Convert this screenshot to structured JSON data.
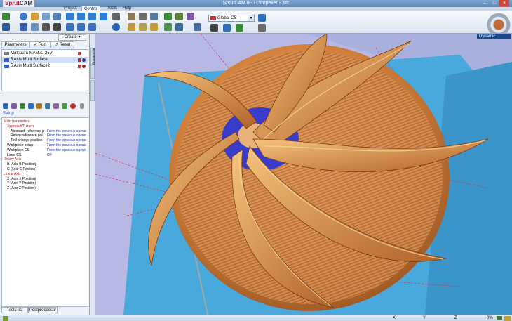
{
  "app": {
    "logo_prefix": "Sprut",
    "logo_suffix": "CAM",
    "window_title": "SprutCAM 8 - D:\\Impeller 3.stc"
  },
  "ribbon": {
    "tabs": [
      "Project",
      "Control",
      "Tools",
      "Help"
    ],
    "active_tab": "Control",
    "coordinate_system": "Global CS"
  },
  "left_panel": {
    "create_label": "Create",
    "buttons": {
      "parameters": "Parameters",
      "run": "Run",
      "reset": "Reset"
    },
    "operations": [
      {
        "label": "Matsuura MAM72 25V",
        "selected": false
      },
      {
        "label": "5 Axis Multi Surface",
        "selected": true
      },
      {
        "label": "5 Axis Multi Surface2",
        "selected": false
      }
    ],
    "setup_label": "Setup",
    "parameters": [
      {
        "key": "Main parameters",
        "value": "",
        "group": true,
        "indent": 0
      },
      {
        "key": "Approach/Return",
        "value": "",
        "group": true,
        "indent": 1
      },
      {
        "key": "Approach reference p",
        "value": "From the previous operat",
        "group": false,
        "indent": 2
      },
      {
        "key": "Return reference poi",
        "value": "From the previous operat",
        "group": false,
        "indent": 2
      },
      {
        "key": "Tool change position",
        "value": "From the previous operat",
        "group": false,
        "indent": 2
      },
      {
        "key": "Workpiece setup",
        "value": "From the previous operat",
        "group": false,
        "indent": 1
      },
      {
        "key": "Workpiece CS",
        "value": "From the previous operat",
        "group": false,
        "indent": 1
      },
      {
        "key": "Local CS",
        "value": "Off",
        "group": false,
        "indent": 1
      },
      {
        "key": "Rotary Axis",
        "value": "",
        "group": true,
        "indent": 0
      },
      {
        "key": "B (Axis B Position)",
        "value": "",
        "group": false,
        "indent": 1
      },
      {
        "key": "C (Axis C Position)",
        "value": "",
        "group": false,
        "indent": 1
      },
      {
        "key": "Linear Axis",
        "value": "",
        "group": true,
        "indent": 0
      },
      {
        "key": "X (Axis X Position)",
        "value": "",
        "group": false,
        "indent": 1
      },
      {
        "key": "Y (Axis Y Position)",
        "value": "",
        "group": false,
        "indent": 1
      },
      {
        "key": "Z (Axis Z Position)",
        "value": "",
        "group": false,
        "indent": 1
      }
    ],
    "bottom_tabs": [
      "Tools list",
      "Postprocessor"
    ]
  },
  "side_tabs": [
    "Machining"
  ],
  "viewport": {
    "view_mode": "Dynamic"
  },
  "status_bar": {
    "x_label": "X",
    "y_label": "Y",
    "z_label": "Z",
    "progress": "0%"
  },
  "colors": {
    "impeller": "#d8892e",
    "toolpath_blue": "#1f2fe0",
    "stock_blue": "#46a8db",
    "background_lavender": "#b7b9e4"
  }
}
